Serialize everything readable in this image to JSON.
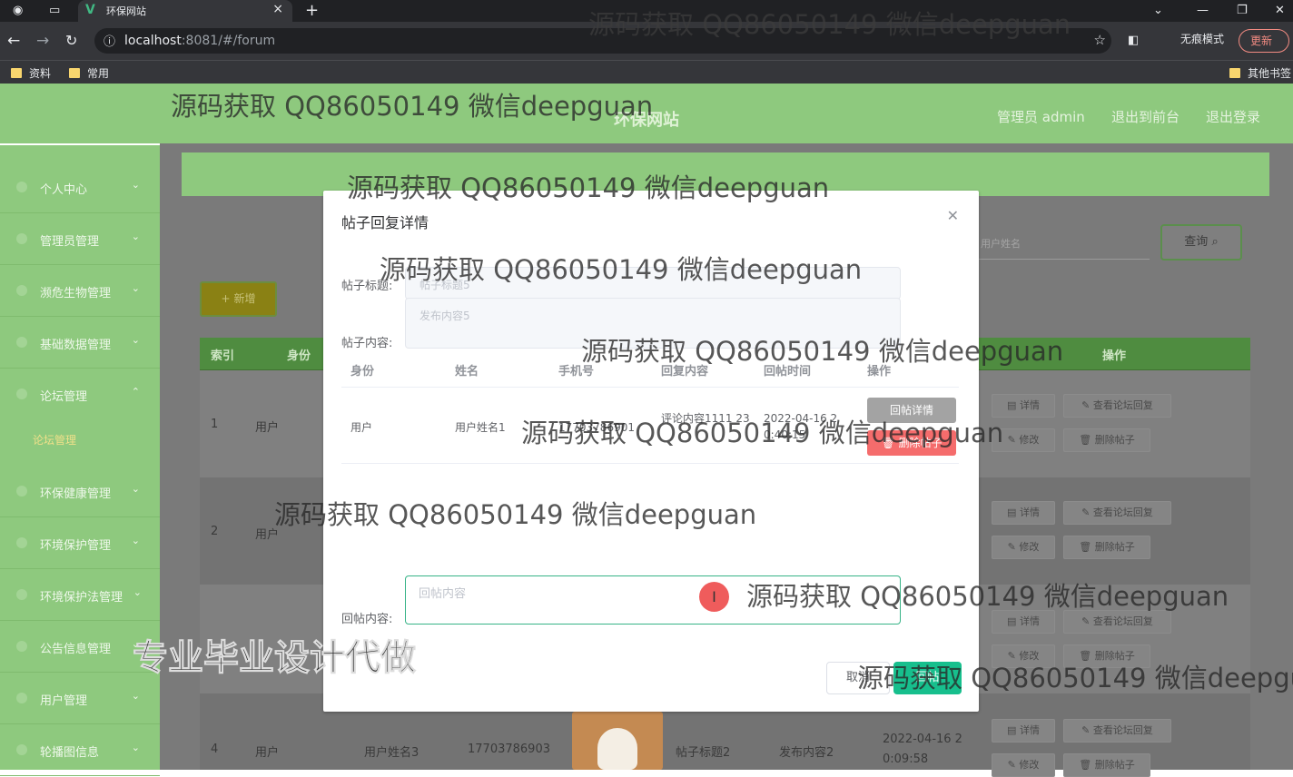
{
  "browser": {
    "tab_title": "环保网站",
    "url_host": "localhost",
    "url_rest": ":8081/#/forum",
    "incognito_label": "无痕模式",
    "update_label": "更新",
    "bookmarks": [
      "资料",
      "常用",
      "其他书签"
    ]
  },
  "header": {
    "site_title": "环保网站",
    "links": [
      "管理员 admin",
      "退出到前台",
      "退出登录"
    ]
  },
  "sidebar": {
    "items": [
      {
        "label": "个人中心"
      },
      {
        "label": "管理员管理"
      },
      {
        "label": "濒危生物管理"
      },
      {
        "label": "基础数据管理"
      },
      {
        "label": "论坛管理"
      },
      {
        "label": "环保健康管理"
      },
      {
        "label": "环境保护管理"
      },
      {
        "label": "环境保护法管理"
      },
      {
        "label": "公告信息管理"
      },
      {
        "label": "用户管理"
      },
      {
        "label": "轮播图信息"
      }
    ],
    "active_sub": "论坛管理"
  },
  "toolbar": {
    "search_placeholder": "用户姓名",
    "query_label": "查询",
    "add_label": "新增"
  },
  "table": {
    "headers": [
      "索引",
      "身份",
      "操作"
    ],
    "rows": [
      {
        "index": "1",
        "role": "用户",
        "name": "",
        "phone": "",
        "title": "",
        "content": "",
        "time": ""
      },
      {
        "index": "2",
        "role": "用户",
        "name": "",
        "phone": "",
        "title": "",
        "content": "",
        "time": ""
      },
      {
        "index": "4",
        "role": "用户",
        "name": "用户姓名3",
        "phone": "17703786903",
        "title": "帖子标题2",
        "content": "发布内容2",
        "time": "2022-04-16 2 0:09:58"
      }
    ],
    "actions": {
      "detail": "详情",
      "view_replies": "查看论坛回复",
      "edit": "修改",
      "delete": "删除帖子"
    }
  },
  "dialog": {
    "title": "帖子回复详情",
    "post_title_label": "帖子标题:",
    "post_title_value": "帖子标题5",
    "post_content_label": "帖子内容:",
    "post_content_value": "发布内容5",
    "reply_headers": [
      "身份",
      "姓名",
      "手机号",
      "回复内容",
      "回帖时间",
      "操作"
    ],
    "reply_row": {
      "role": "用户",
      "name": "用户姓名1",
      "phone": "17703786901",
      "content": "评论内容1111 23",
      "time": "2022-04-16 2 0:40:15",
      "detail_button": "回帖详情",
      "delete_button": "删除帖子"
    },
    "reply_label": "回帖内容:",
    "reply_placeholder": "回帖内容",
    "cancel_label": "取消",
    "submit_label": "回帖"
  },
  "watermarks": {
    "text": "源码获取 QQ86050149 微信deepguan",
    "big": "专业毕业设计代做"
  }
}
